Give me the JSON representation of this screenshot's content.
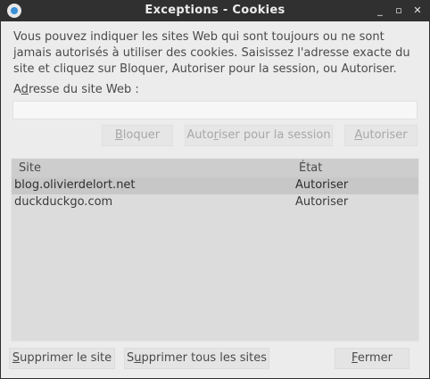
{
  "window": {
    "title": "Exceptions - Cookies",
    "controls": {
      "minimize": "_",
      "maximize": "▫",
      "close": "✕"
    }
  },
  "description": "Vous pouvez indiquer les sites Web qui sont toujours ou ne sont jamais autorisés à utiliser des cookies. Saisissez l'adresse exacte du site et cliquez sur Bloquer, Autoriser pour la session, ou Autoriser.",
  "site_field": {
    "label_prefix": "A",
    "label_mnemonic": "d",
    "label_suffix": "resse du site Web :",
    "value": "",
    "placeholder": ""
  },
  "actions": {
    "block": {
      "mnemonic": "B",
      "rest": "loquer"
    },
    "session": {
      "pre": "Auto",
      "mnemonic": "r",
      "rest": "iser pour la session"
    },
    "allow": {
      "mnemonic": "A",
      "rest": "utoriser"
    }
  },
  "table": {
    "columns": {
      "site": "Site",
      "state": "État"
    },
    "rows": [
      {
        "site": "blog.olivierdelort.net",
        "state": "Autoriser",
        "selected": true
      },
      {
        "site": "duckduckgo.com",
        "state": "Autoriser",
        "selected": false
      }
    ]
  },
  "footer": {
    "remove": {
      "mnemonic": "S",
      "rest": "upprimer le site"
    },
    "remove_all": {
      "pre": "S",
      "mnemonic": "u",
      "rest": "pprimer tous les sites"
    },
    "close": {
      "mnemonic": "F",
      "rest": "ermer"
    }
  },
  "colors": {
    "dialog_bg": "#ececec",
    "titlebar_bg": "#303030",
    "selected_row": "#c7c7c7",
    "header_bg": "#cdcdcd"
  }
}
